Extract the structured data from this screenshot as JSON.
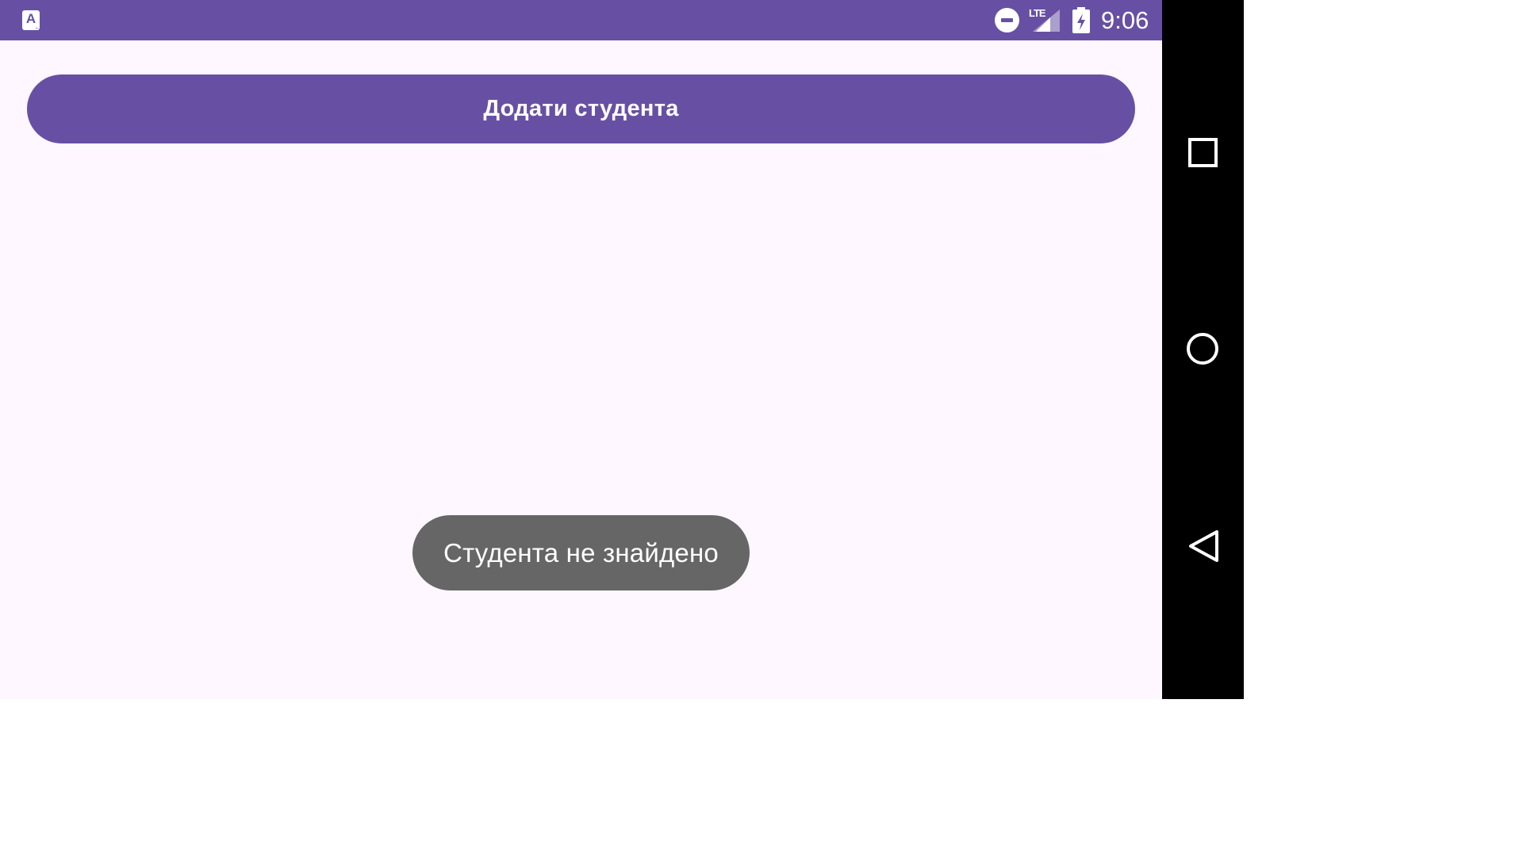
{
  "status_bar": {
    "app_icon_letter": "A",
    "network_label": "LTE",
    "time": "9:06",
    "icons": [
      "app-notification-icon",
      "do-not-disturb-icon",
      "signal-icon",
      "battery-charging-icon"
    ]
  },
  "main": {
    "add_student_button_label": "Додати студента"
  },
  "toast": {
    "message": "Студента не знайдено"
  },
  "nav_bar": {
    "buttons": [
      "recents-icon",
      "home-icon",
      "back-icon"
    ]
  },
  "colors": {
    "primary": "#6750A4",
    "background": "#FEF7FF",
    "toast_background": "#666666",
    "nav_bar": "#000000"
  }
}
